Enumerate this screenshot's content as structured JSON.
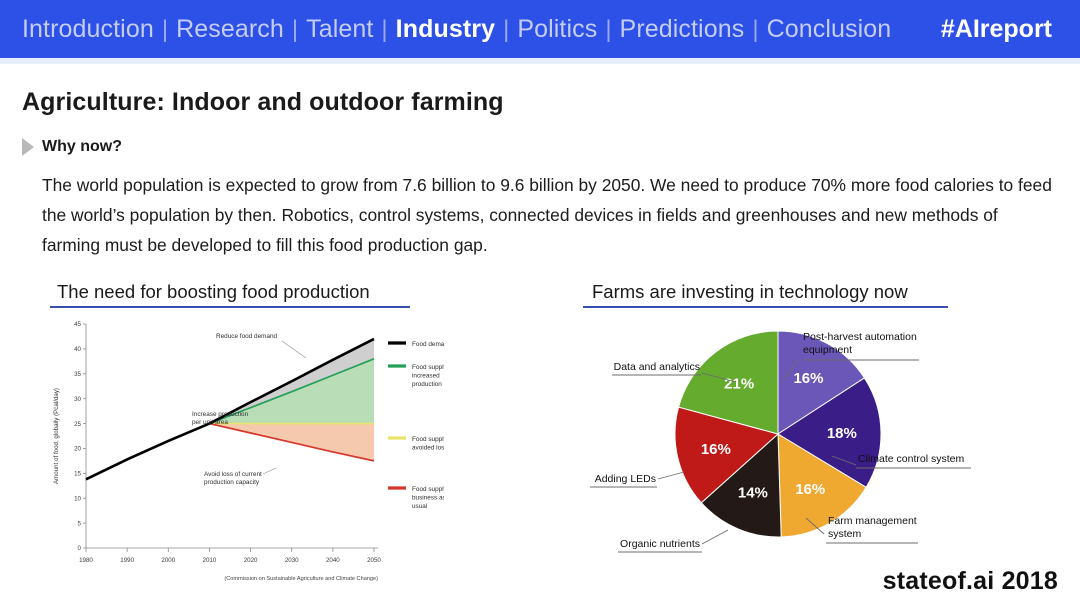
{
  "nav": {
    "items": [
      {
        "label": "Introduction",
        "active": false
      },
      {
        "label": "Research",
        "active": false
      },
      {
        "label": "Talent",
        "active": false
      },
      {
        "label": "Industry",
        "active": true
      },
      {
        "label": "Politics",
        "active": false
      },
      {
        "label": "Predictions",
        "active": false
      },
      {
        "label": "Conclusion",
        "active": false
      }
    ],
    "separator": "|",
    "hashtag": "#AIreport",
    "bar_color": "#2d50e6",
    "active_color": "#ffffff",
    "inactive_color": "#c3cdf5"
  },
  "slide": {
    "title": "Agriculture: Indoor and outdoor farming",
    "why_now_label": "Why now?",
    "body": "The world population is expected to grow from 7.6 billion to 9.6 billion by 2050. We need to produce 70% more food calories to feed the world’s population by then. Robotics, control systems, connected devices in fields and greenhouses and new methods of farming must be developed to fill this food production gap.",
    "brand": "stateof.ai 2018",
    "left_caption": "The need for boosting food production",
    "right_caption": "Farms are investing in technology now",
    "rule_color": "#3b4fae"
  },
  "chart_data": [
    {
      "type": "line",
      "title": "The need for boosting food production",
      "xlabel": "",
      "ylabel": "Amount of food, globally (Pcal/day)",
      "source": "(Commission on Sustainable Agriculture and Climate Change)",
      "x": [
        1980,
        1990,
        2000,
        2010,
        2020,
        2030,
        2040,
        2050
      ],
      "xlim": [
        1980,
        2050
      ],
      "ylim": [
        0,
        45
      ],
      "yticks": [
        0,
        5,
        10,
        15,
        20,
        25,
        30,
        35,
        40,
        45
      ],
      "xticks": [
        1980,
        1990,
        2000,
        2010,
        2020,
        2030,
        2040,
        2050
      ],
      "grid": false,
      "legend_position": "right",
      "series": [
        {
          "name": "Food demand",
          "color": "#000000",
          "values": [
            13.8,
            17.8,
            21.5,
            25.0,
            29.3,
            33.5,
            37.8,
            42.0
          ]
        },
        {
          "name": "Food supply – increased production",
          "color": "#23a05a",
          "values": [
            13.8,
            17.8,
            21.5,
            25.0,
            28.2,
            31.4,
            34.7,
            38.0
          ]
        },
        {
          "name": "Food supply – avoided losses",
          "color": "#e8e46a",
          "values": [
            13.8,
            17.8,
            21.5,
            25.0,
            25.0,
            25.0,
            25.0,
            25.0
          ]
        },
        {
          "name": "Food supply – business as usual",
          "color": "#d7372b",
          "values": [
            13.8,
            17.8,
            21.5,
            25.0,
            23.1,
            21.2,
            19.3,
            17.5
          ]
        }
      ],
      "annotations": [
        {
          "text": "Reduce food demand"
        },
        {
          "text": "Increase production per unit area"
        },
        {
          "text": "Avoid loss of current production capacity"
        }
      ]
    },
    {
      "type": "pie",
      "title": "Farms are investing in technology now",
      "labels": [
        "Post-harvest automation equipment",
        "Climate control system",
        "Farm management system",
        "Organic nutrients",
        "Adding LEDs",
        "Data and analytics"
      ],
      "values": [
        16,
        18,
        16,
        14,
        16,
        21
      ],
      "value_labels": [
        "16%",
        "18%",
        "16%",
        "14%",
        "16%",
        "21%"
      ],
      "colors": [
        "#6a57b8",
        "#3a1d86",
        "#efa830",
        "#231a17",
        "#c01a18",
        "#64ab2e"
      ],
      "legend_position": "callout"
    }
  ]
}
